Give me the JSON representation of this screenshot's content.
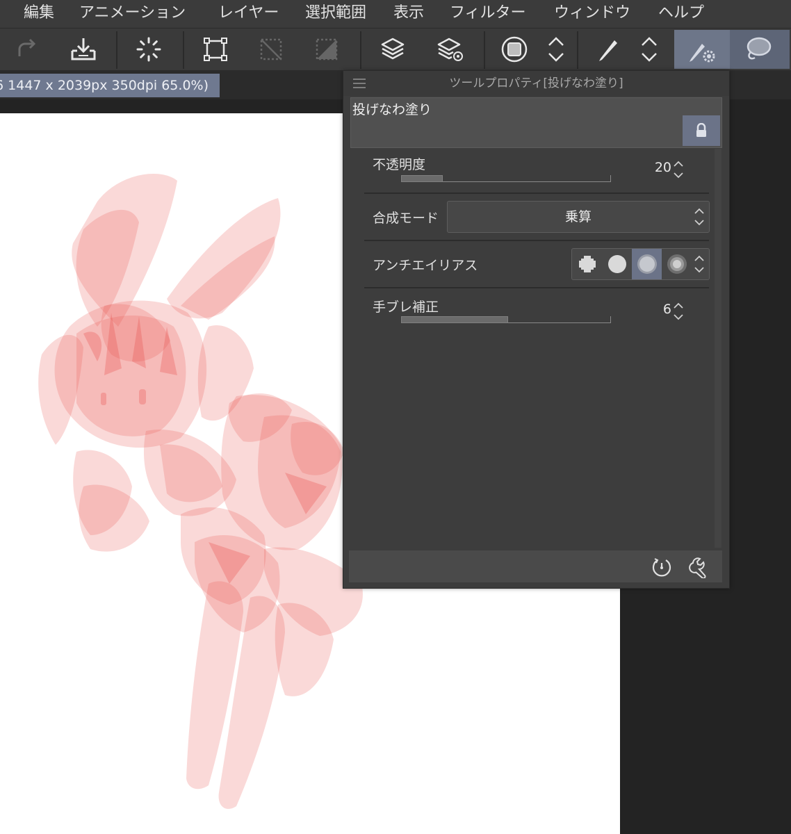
{
  "menu": [
    "編集",
    "アニメーション",
    "レイヤー",
    "選択範囲",
    "表示",
    "フィルター",
    "ウィンドウ",
    "ヘルプ"
  ],
  "toolbar": {
    "buttons": [
      "redo-icon",
      "save-icon",
      "loading-icon",
      "transform-icon",
      "deselect-icon",
      "invert-selection-icon",
      "layers-icon",
      "layer-properties-icon",
      "color-circle-icon",
      "chevron-updown-icon",
      "pen-icon",
      "chevron-updown-icon",
      "tool-settings-icon",
      "lasso-fill-icon"
    ]
  },
  "document_tab": "6 1447 x 2039px 350dpi 65.0%)",
  "panel": {
    "title": "ツールプロパティ[投げなわ塗り]",
    "preset_name": "投げなわ塗り",
    "opacity": {
      "label": "不透明度",
      "value": "20",
      "level": 0.2
    },
    "blend_mode": {
      "label": "合成モード",
      "value": "乗算"
    },
    "antialias": {
      "label": "アンチエイリアス",
      "options": [
        "none",
        "weak",
        "medium",
        "strong"
      ],
      "selected": "medium"
    },
    "stabilization": {
      "label": "手ブレ補正",
      "value": "6",
      "level": 0.51
    },
    "footer_icons": [
      "reset-icon",
      "settings-wrench-icon"
    ]
  },
  "colors": {
    "accent": "#6d7689",
    "panel_bg": "#3d3d3d",
    "sketch": "#e8514d"
  }
}
